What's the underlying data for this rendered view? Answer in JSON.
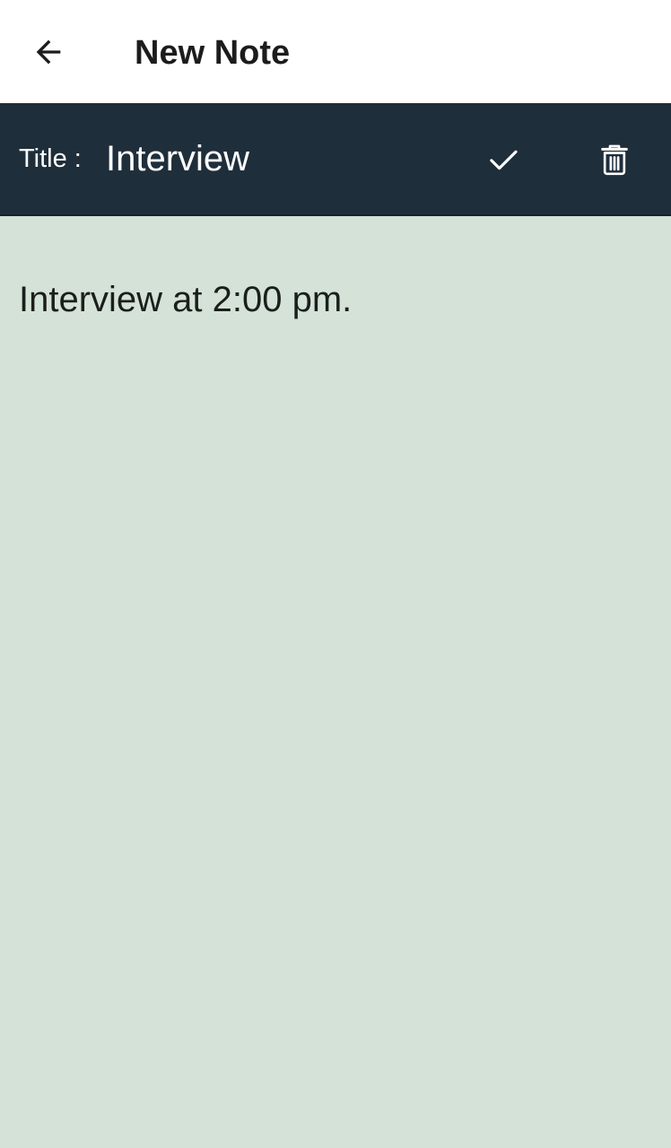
{
  "app_bar": {
    "back_icon": "arrow-left-icon",
    "title": "New Note"
  },
  "title_bar": {
    "label": "Title :",
    "title_value": "Interview",
    "save_icon": "check-icon",
    "delete_icon": "trash-icon",
    "background_color": "#1f2e3b"
  },
  "note": {
    "content": "Interview at 2:00 pm.",
    "background_color": "#d5e2d8"
  }
}
